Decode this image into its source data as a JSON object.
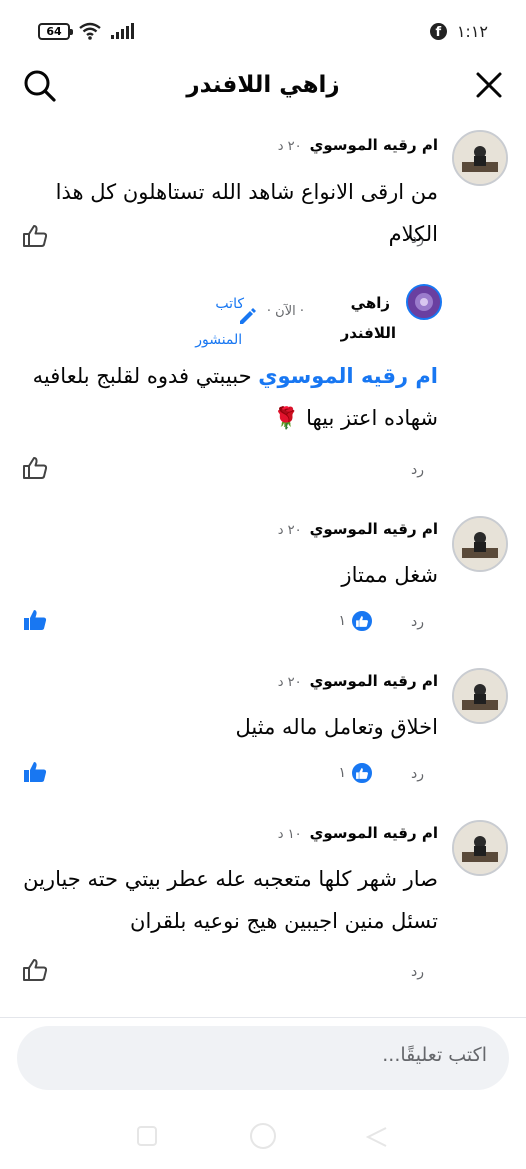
{
  "status": {
    "time": "١:١٢",
    "battery": "64"
  },
  "header": {
    "title": "زاهي اللافندر"
  },
  "comments": [
    {
      "author": "ام رقيه الموسوي",
      "time": "٢٠ د",
      "lines": [
        "من ارقى الانواع شاهد الله تستاهلون كل هذا الكلام"
      ],
      "reply": "رد"
    },
    {
      "author_line1": "زاهي",
      "author_line2": "اللافندر",
      "time": "· الآن ·",
      "badge_line1": "كاتب",
      "badge_line2": "المنشور",
      "mention": "ام رقيه الموسوي",
      "line1_rest": " حبيبتي فدوه لقلبج بلعافيه",
      "line2": "شهاده اعتز بيها 🌹",
      "reply": "رد"
    },
    {
      "author": "ام رقيه الموسوي",
      "time": "٢٠ د",
      "lines": [
        "شغل ممتاز"
      ],
      "reply": "رد",
      "reactions": "١"
    },
    {
      "author": "ام رقيه الموسوي",
      "time": "٢٠ د",
      "lines": [
        "اخلاق وتعامل ماله مثيل"
      ],
      "reply": "رد",
      "reactions": "١"
    },
    {
      "author": "ام رقيه الموسوي",
      "time": "١٠ د",
      "lines": [
        "صار شهر كلها متعجبه عله عطر بيتي حته جيارين",
        "تسئل منين اجيبين هيج نوعيه بلقران"
      ],
      "reply": "رد"
    }
  ],
  "composer": {
    "placeholder": "اكتب تعليقًا..."
  },
  "colors": {
    "accent": "#1877f2",
    "muted": "#65676b",
    "compose_bg": "#f0f2f5"
  },
  "icons": [
    "search-icon",
    "close-icon",
    "like-icon",
    "like-filled-icon",
    "reaction-like-icon",
    "edit-pencil-icon",
    "facebook-icon",
    "wifi-icon",
    "signal-icon",
    "battery-icon"
  ]
}
